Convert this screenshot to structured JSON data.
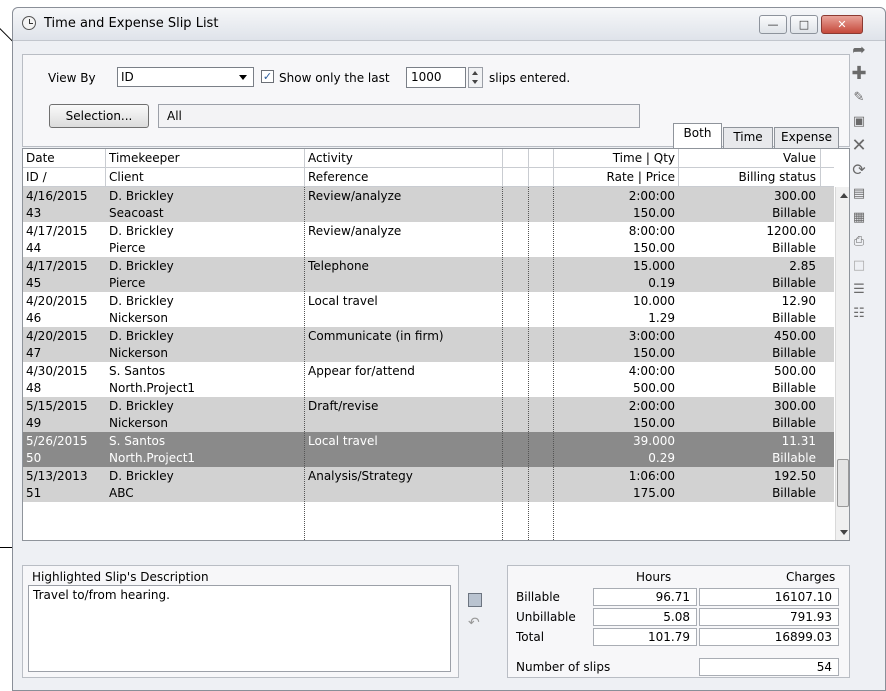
{
  "window": {
    "title": "Time and Expense Slip List"
  },
  "filters": {
    "view_by_label": "View By",
    "view_by_value": "ID",
    "show_only_label": "Show only the last",
    "slip_count": "1000",
    "slips_entered_label": "slips entered.",
    "selection_button": "Selection...",
    "selection_value": "All"
  },
  "tabs": [
    "Both",
    "Time",
    "Expense"
  ],
  "grid": {
    "header1": [
      "Date",
      "Timekeeper",
      "Activity",
      "Time | Qty",
      "Value"
    ],
    "header2": [
      "ID /",
      "Client",
      "Reference",
      "Rate | Price",
      "Billing status"
    ],
    "rows": [
      {
        "date": "4/16/2015",
        "id": "43",
        "timekeeper": "D. Brickley",
        "client": "Seacoast",
        "activity": "Review/analyze",
        "qty": "2:00:00",
        "rate": "150.00",
        "value": "300.00",
        "status": "Billable"
      },
      {
        "date": "4/17/2015",
        "id": "44",
        "timekeeper": "D. Brickley",
        "client": "Pierce",
        "activity": "Review/analyze",
        "qty": "8:00:00",
        "rate": "150.00",
        "value": "1200.00",
        "status": "Billable"
      },
      {
        "date": "4/17/2015",
        "id": "45",
        "timekeeper": "D. Brickley",
        "client": "Pierce",
        "activity": "Telephone",
        "qty": "15.000",
        "rate": "0.19",
        "value": "2.85",
        "status": "Billable"
      },
      {
        "date": "4/20/2015",
        "id": "46",
        "timekeeper": "D. Brickley",
        "client": "Nickerson",
        "activity": "Local travel",
        "qty": "10.000",
        "rate": "1.29",
        "value": "12.90",
        "status": "Billable"
      },
      {
        "date": "4/20/2015",
        "id": "47",
        "timekeeper": "D. Brickley",
        "client": "Nickerson",
        "activity": "Communicate (in firm)",
        "qty": "3:00:00",
        "rate": "150.00",
        "value": "450.00",
        "status": "Billable"
      },
      {
        "date": "4/30/2015",
        "id": "48",
        "timekeeper": "S. Santos",
        "client": "North.Project1",
        "activity": "Appear for/attend",
        "qty": "4:00:00",
        "rate": "500.00",
        "value": "500.00",
        "status": "Billable"
      },
      {
        "date": "5/15/2015",
        "id": "49",
        "timekeeper": "D. Brickley",
        "client": "Nickerson",
        "activity": "Draft/revise",
        "qty": "2:00:00",
        "rate": "150.00",
        "value": "300.00",
        "status": "Billable"
      },
      {
        "date": "5/26/2015",
        "id": "50",
        "timekeeper": "S. Santos",
        "client": "North.Project1",
        "activity": "Local travel",
        "qty": "39.000",
        "rate": "0.29",
        "value": "11.31",
        "status": "Billable"
      },
      {
        "date": "5/13/2013",
        "id": "51",
        "timekeeper": "D. Brickley",
        "client": "ABC",
        "activity": "Analysis/Strategy",
        "qty": "1:06:00",
        "rate": "175.00",
        "value": "192.50",
        "status": "Billable"
      }
    ]
  },
  "description": {
    "title": "Highlighted Slip's Description",
    "text": "Travel to/from hearing."
  },
  "totals": {
    "hours_label": "Hours",
    "charges_label": "Charges",
    "billable_label": "Billable",
    "billable_hours": "96.71",
    "billable_charges": "16107.10",
    "unbillable_label": "Unbillable",
    "unbillable_hours": "5.08",
    "unbillable_charges": "791.93",
    "total_label": "Total",
    "total_hours": "101.79",
    "total_charges": "16899.03",
    "slips_label": "Number of slips",
    "slips_count": "54"
  },
  "toolbar_icons": [
    "goto-icon",
    "add-icon",
    "edit-icon",
    "open-icon",
    "delete-icon",
    "refresh-icon",
    "book-icon",
    "report-icon",
    "print-icon",
    "blank-icon",
    "list-icon",
    "layout-icon"
  ],
  "selected_row_index": 7
}
